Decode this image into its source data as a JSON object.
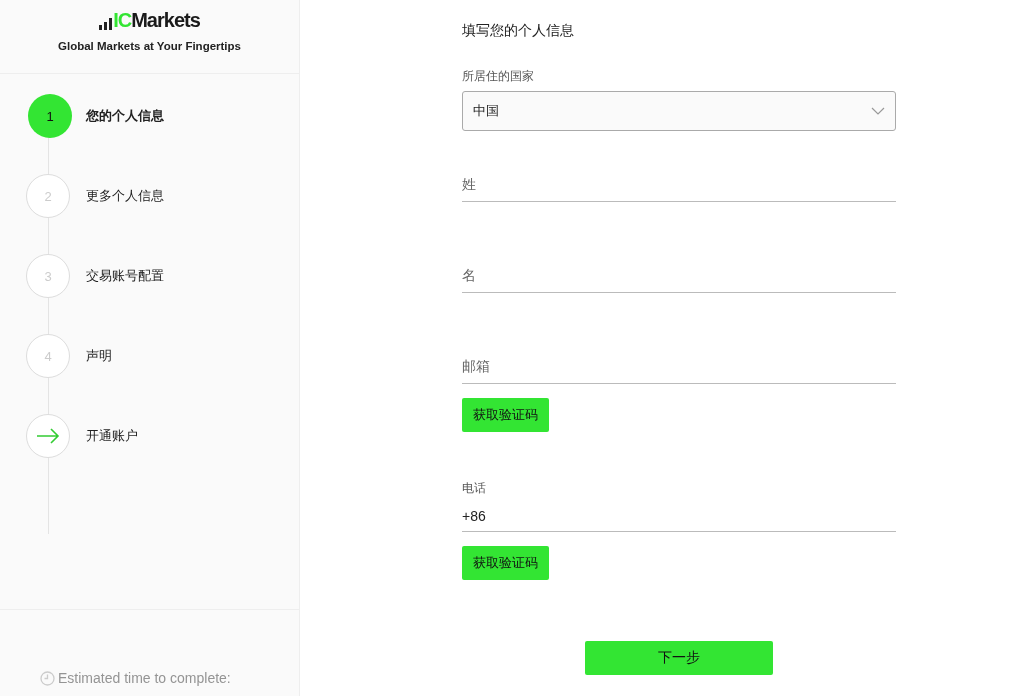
{
  "logo": {
    "prefix": "IC",
    "name": "Markets",
    "tagline": "Global Markets at Your Fingertips"
  },
  "steps": [
    {
      "kind": "number",
      "number": "1",
      "label": "您的个人信息",
      "selected": true
    },
    {
      "kind": "number",
      "number": "2",
      "label": "更多个人信息",
      "selected": false
    },
    {
      "kind": "number",
      "number": "3",
      "label": "交易账号配置",
      "selected": false
    },
    {
      "kind": "number",
      "number": "4",
      "label": "声明",
      "selected": false
    },
    {
      "kind": "arrow",
      "label": "开通账户",
      "selected": false
    }
  ],
  "footer": {
    "text": "Estimated time to complete:"
  },
  "form": {
    "title": "填写您的个人信息",
    "fields": [
      {
        "kind": "select",
        "label": "所居住的国家",
        "value": "中国"
      },
      {
        "kind": "text",
        "placeholder": "姓"
      },
      {
        "kind": "text",
        "placeholder": "名"
      },
      {
        "kind": "text",
        "placeholder": "邮箱",
        "button": "获取验证码"
      },
      {
        "kind": "labeled",
        "label": "电话",
        "value": "+86",
        "button": "获取验证码"
      }
    ],
    "next_button": "下一步"
  }
}
